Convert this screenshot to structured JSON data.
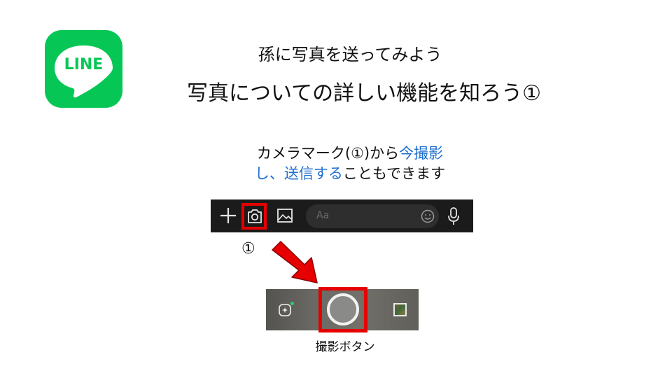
{
  "logo": {
    "text": "LINE",
    "brand_color": "#06c755"
  },
  "heading": {
    "subtitle": "孫に写真を送ってみよう",
    "title": "写真についての詳しい機能を知ろう①"
  },
  "instruction": {
    "part1": "カメラマーク(①)から",
    "highlight1": "今撮影",
    "highlight2": "し、送信する",
    "part2": "こともできます",
    "highlight_color": "#1f6fd0"
  },
  "input_bar": {
    "plus_icon": "plus-icon",
    "camera_icon": "camera-icon",
    "image_icon": "image-icon",
    "placeholder": "Aa",
    "emoji_icon": "emoji-icon",
    "mic_icon": "microphone-icon"
  },
  "marker_label": "①",
  "arrow_color": "#e60000",
  "camera": {
    "effects_icon": "effects-icon",
    "shutter": "shutter-button",
    "gallery_icon": "gallery-thumbnail"
  },
  "caption": "撮影ボタン"
}
